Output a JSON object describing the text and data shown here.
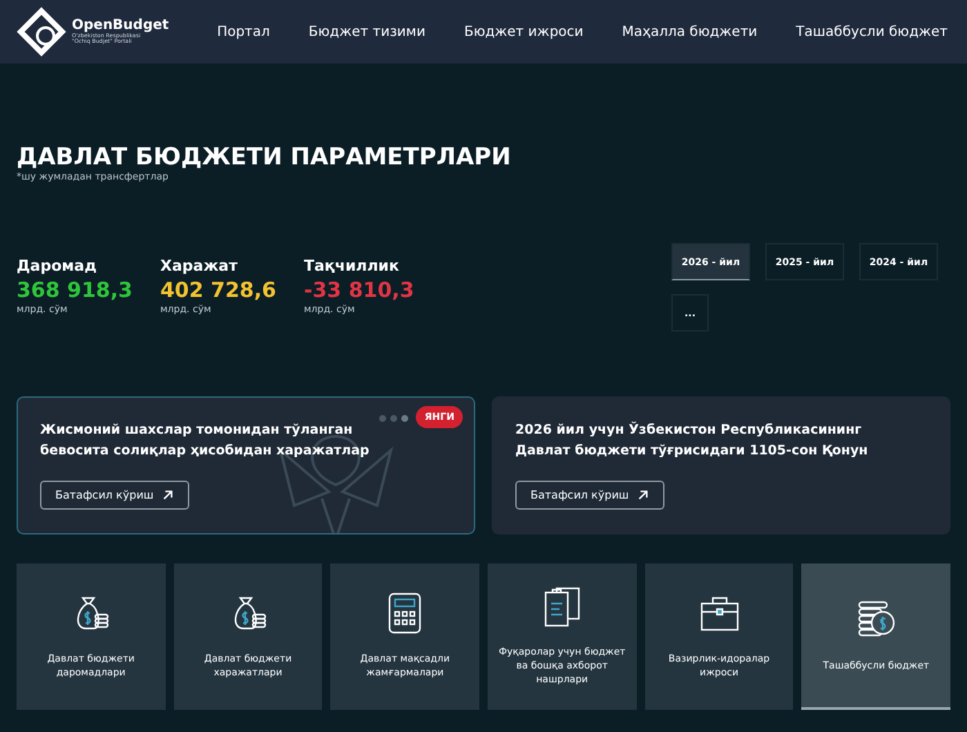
{
  "header": {
    "logo": {
      "name": "OpenBudget",
      "subtitle_lines": [
        "O'zbekiston Respublikasi",
        "\"Ochiq Budjet\" Portali"
      ]
    },
    "nav": [
      "Портал",
      "Бюджет тизими",
      "Бюджет ижроси",
      "Маҳалла бюджети",
      "Ташаббусли бюджет"
    ]
  },
  "page": {
    "title": "ДАВЛАТ БЮДЖЕТИ ПАРАМЕТРЛАРИ",
    "note": "*шу жумладан трансфертлар"
  },
  "stats": [
    {
      "label": "Даромад",
      "value": "368 918,3",
      "unit": "млрд. сўм",
      "color": "#2fc53a"
    },
    {
      "label": "Харажат",
      "value": "402 728,6",
      "unit": "млрд. сўм",
      "color": "#f2c230"
    },
    {
      "label": "Тақчиллик",
      "value": "-33 810,3",
      "unit": "млрд. сўм",
      "color": "#e23444"
    }
  ],
  "years": [
    {
      "label": "2026 - йил",
      "selected": true
    },
    {
      "label": "2025 - йил",
      "selected": false
    },
    {
      "label": "2024 - йил",
      "selected": false
    },
    {
      "label": "...",
      "selected": false
    }
  ],
  "cards": [
    {
      "text": "Жисмоний шахслар томонидан тўланган бевосита солиқлар ҳисобидан харажатлар",
      "badge": "ЯНГИ",
      "button": "Батафсил кўриш",
      "highlighted": true
    },
    {
      "text": "2026 йил учун Ўзбекистон Республикасининг Давлат бюджети тўғрисидаги 1105-сон Қонун",
      "button": "Батафсил кўриш",
      "highlighted": false
    }
  ],
  "tiles": [
    {
      "kind": "moneybag",
      "label": "Давлат бюджети даромадлари",
      "selected": false
    },
    {
      "kind": "moneybag",
      "label": "Давлат бюджети харажатлари",
      "selected": false
    },
    {
      "kind": "calculator",
      "label": "Давлат мақсадли жамғармалари",
      "selected": false
    },
    {
      "kind": "documents",
      "label": "Фуқаролар учун бюджет ва бошқа ахборот нашрлари",
      "selected": false
    },
    {
      "kind": "briefcase",
      "label": "Вазирлик-идоралар ижроси",
      "selected": false
    },
    {
      "kind": "coins",
      "label": "Ташаббусли бюджет",
      "selected": true
    }
  ]
}
